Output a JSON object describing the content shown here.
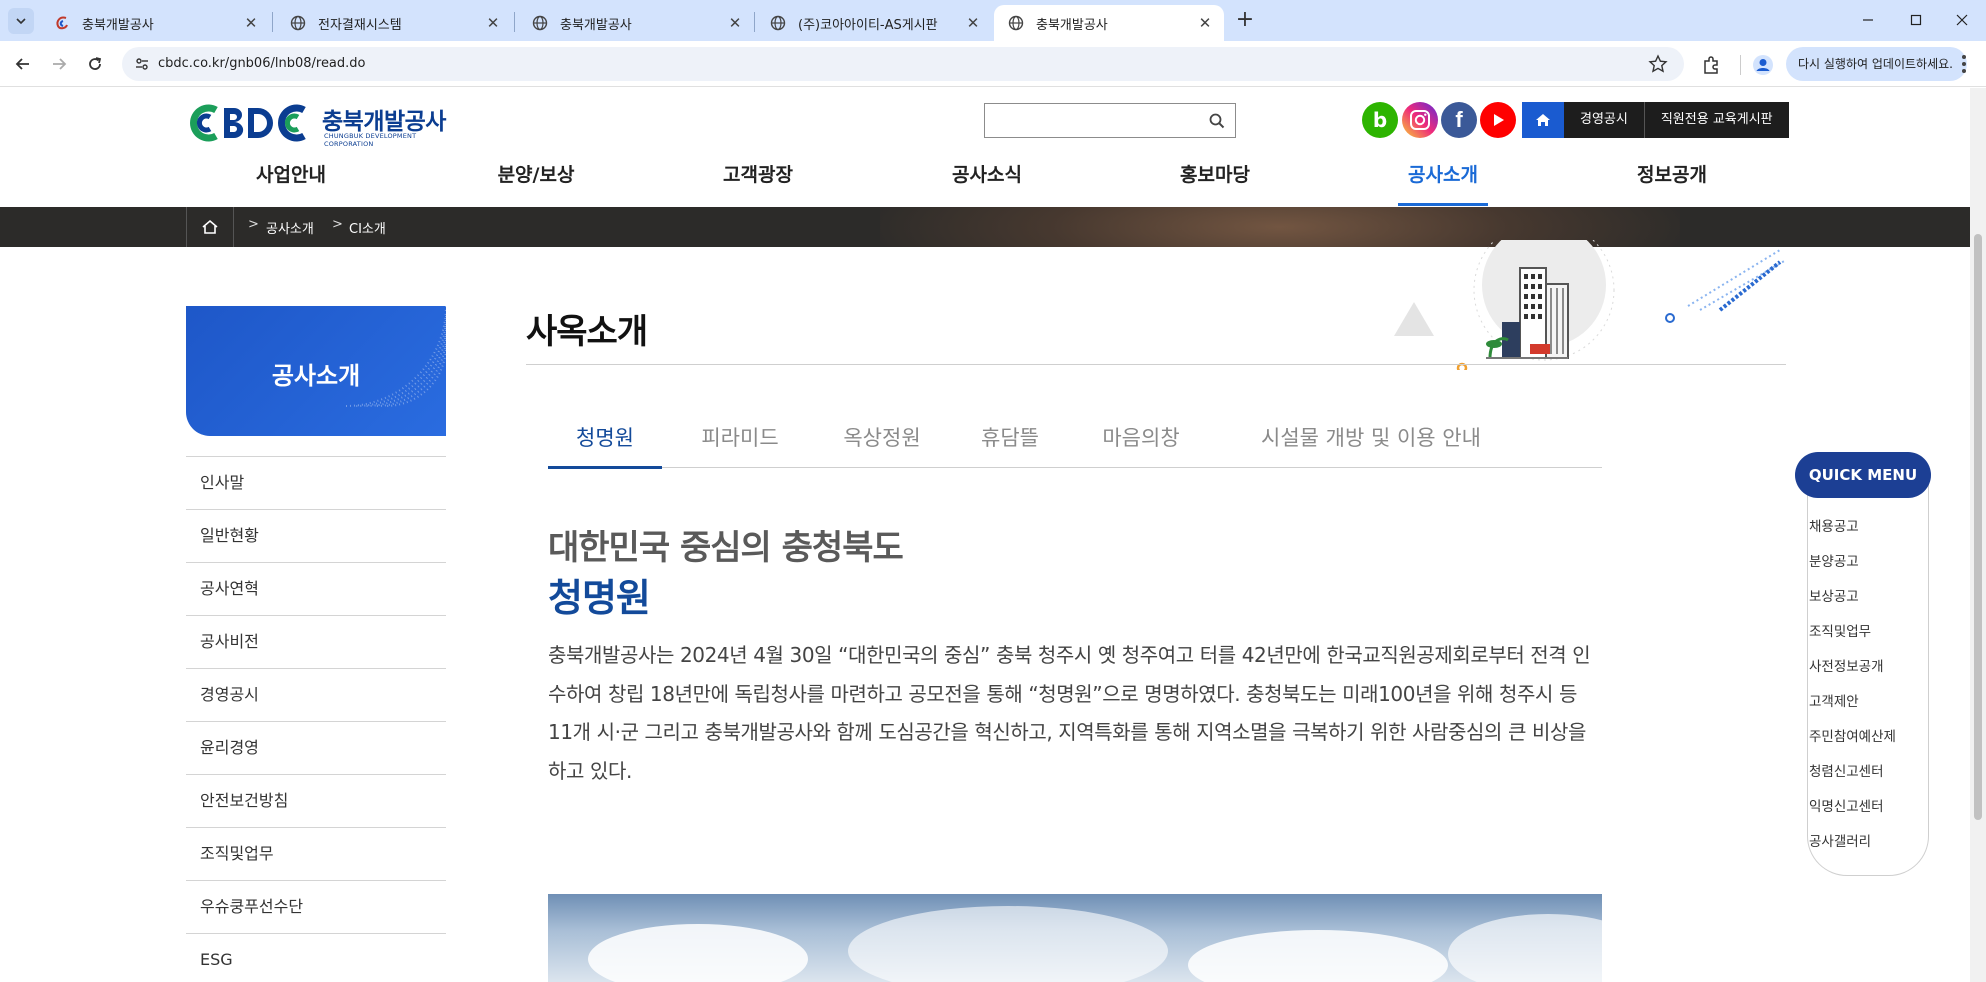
{
  "browser": {
    "tabs": [
      {
        "title": "충북개발공사",
        "active": false
      },
      {
        "title": "전자결재시스템",
        "active": false
      },
      {
        "title": "충북개발공사",
        "active": false
      },
      {
        "title": "(주)코아아이티-AS게시판",
        "active": false
      },
      {
        "title": "충북개발공사",
        "active": true
      }
    ],
    "url": "cbdc.co.kr/gnb06/lnb08/read.do",
    "update_label": "다시 실행하여 업데이트하세요."
  },
  "site": {
    "logo_mark": "CBDC",
    "logo_name": "충북개발공사",
    "logo_sub": "CHUNGBUK DEVELOPMENT CORPORATION",
    "search_placeholder": "",
    "sns": [
      {
        "icon": "blog-icon",
        "glyph": "b",
        "color": "#2db400"
      },
      {
        "icon": "instagram-icon",
        "glyph": "",
        "color": "#d62976"
      },
      {
        "icon": "facebook-icon",
        "glyph": "f",
        "color": "#3b5998"
      },
      {
        "icon": "youtube-icon",
        "glyph": "",
        "color": "#ff0000"
      }
    ],
    "top_links": [
      "경영공시",
      "직원전용 교육게시판"
    ],
    "gnb": [
      "사업안내",
      "분양/보상",
      "고객광장",
      "공사소식",
      "홍보마당",
      "공사소개",
      "정보공개"
    ],
    "gnb_active": "공사소개",
    "breadcrumb": [
      "공사소개",
      "CI소개"
    ]
  },
  "lnb": {
    "title": "공사소개",
    "items": [
      "인사말",
      "일반현황",
      "공사연혁",
      "공사비전",
      "경영공시",
      "윤리경영",
      "안전보건방침",
      "조직및업무",
      "우슈쿵푸선수단",
      "ESG"
    ]
  },
  "content": {
    "page_title": "사옥소개",
    "tabs": [
      "청명원",
      "피라미드",
      "옥상정원",
      "휴담뜰",
      "마음의창",
      "시설물 개방 및 이용 안내"
    ],
    "active_tab": "청명원",
    "heading1": "대한민국 중심의 충청북도",
    "heading2": "청명원",
    "body": "충북개발공사는 2024년 4월 30일 “대한민국의 중심” 충북 청주시 옛 청주여고 터를 42년만에 한국교직원공제회로부터 전격 인수하여 창립 18년만에 독립청사를 마련하고 공모전을 통해 “청명원”으로 명명하였다. 충청북도는 미래100년을 위해 청주시 등 11개 시·군 그리고 충북개발공사와 함께 도심공간을 혁신하고, 지역특화를 통해 지역소멸을 극복하기 위한 사람중심의 큰 비상을 하고 있다."
  },
  "quick_menu": {
    "title": "QUICK MENU",
    "items": [
      "채용공고",
      "분양공고",
      "보상공고",
      "조직및업무",
      "사전정보공개",
      "고객제안",
      "주민참여예산제",
      "청렴신고센터",
      "익명신고센터",
      "공사갤러리"
    ]
  },
  "colors": {
    "brand_blue": "#1a6ad6",
    "navy": "#134a9a",
    "quick_navy": "#1c3f94"
  }
}
